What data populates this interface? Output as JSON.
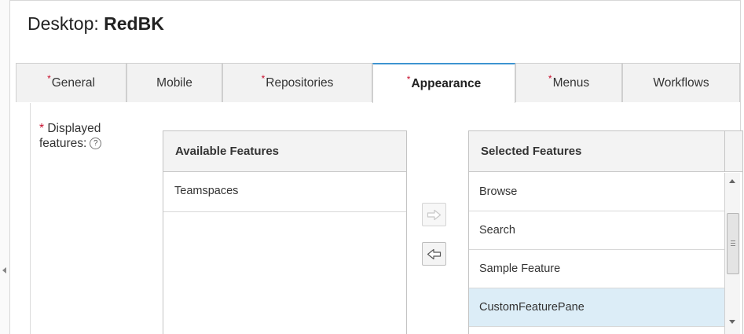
{
  "page": {
    "title_prefix": "Desktop: ",
    "title_name": "RedBK"
  },
  "tabs": [
    {
      "label": "General",
      "required": true,
      "active": false
    },
    {
      "label": "Mobile",
      "required": false,
      "active": false
    },
    {
      "label": "Repositories",
      "required": true,
      "active": false
    },
    {
      "label": "Appearance",
      "required": true,
      "active": true
    },
    {
      "label": "Menus",
      "required": true,
      "active": false
    },
    {
      "label": "Workflows",
      "required": false,
      "active": false
    }
  ],
  "field": {
    "required_mark": "*",
    "label_line1": "Displayed",
    "label_line2": "features:",
    "help_glyph": "?"
  },
  "available": {
    "header": "Available Features",
    "items": [
      "Teamspaces"
    ]
  },
  "selected": {
    "header": "Selected Features",
    "items": [
      "Browse",
      "Search",
      "Sample Feature",
      "CustomFeaturePane"
    ],
    "highlighted_item": "CustomFeaturePane"
  },
  "buttons": {
    "add_icon": "arrow-right-icon",
    "add_enabled": false,
    "remove_icon": "arrow-left-icon",
    "remove_enabled": true
  },
  "colors": {
    "required": "#c8102e",
    "active_tab_accent": "#3d94d1",
    "selected_row": "#dcedf7"
  }
}
